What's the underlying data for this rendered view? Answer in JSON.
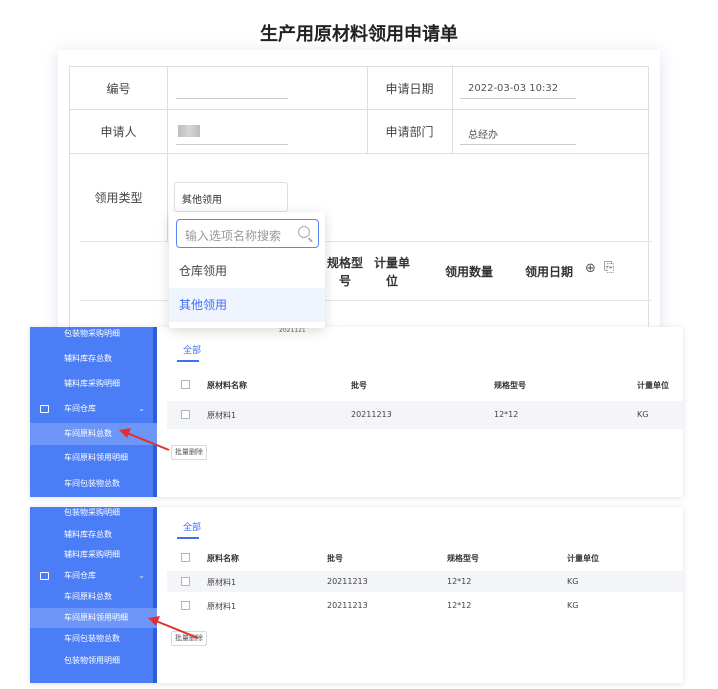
{
  "title": "生产用原材料领用申请单",
  "form": {
    "number_label": "编号",
    "date_label": "申请日期",
    "date_value": "2022-03-03 10:32",
    "applicant_label": "申请人",
    "dept_label": "申请部门",
    "dept_value": "总经办",
    "type_label": "领用类型",
    "type_value": "其他领用",
    "sub_headers": [
      "规格型号",
      "计量单位",
      "领用数量",
      "领用日期"
    ],
    "partial_text": "2021121"
  },
  "dropdown": {
    "search_placeholder": "输入选项名称搜索",
    "options": [
      "仓库领用",
      "其他领用"
    ],
    "selected": "其他领用"
  },
  "panel1": {
    "sidebar": [
      "包装物采购明细",
      "辅料库存总数",
      "辅料库采购明细",
      "车间仓库",
      "车间原料总数",
      "车间原料领用明细",
      "车间包装物总数"
    ],
    "active": "车间原料总数",
    "tab": "全部",
    "headers": [
      "原材料名称",
      "批号",
      "规格型号",
      "计量单位"
    ],
    "rows": [
      [
        "原材料1",
        "20211213",
        "12*12",
        "KG"
      ]
    ],
    "batch_delete": "批量删除"
  },
  "panel2": {
    "sidebar": [
      "包装物采购明细",
      "辅料库存总数",
      "辅料库采购明细",
      "车间仓库",
      "车间原料总数",
      "车间原料领用明细",
      "车间包装物总数",
      "包装物领用明细"
    ],
    "active": "车间原料领用明细",
    "tab": "全部",
    "headers": [
      "原料名称",
      "批号",
      "规格型号",
      "计量单位"
    ],
    "rows": [
      [
        "原材料1",
        "20211213",
        "12*12",
        "KG"
      ],
      [
        "原材料1",
        "20211213",
        "12*12",
        "KG"
      ]
    ],
    "batch_delete": "批量删除"
  },
  "colors": {
    "sidebar": "#4a7df6",
    "accent": "#3d6ff4",
    "arrow": "#e03030"
  }
}
